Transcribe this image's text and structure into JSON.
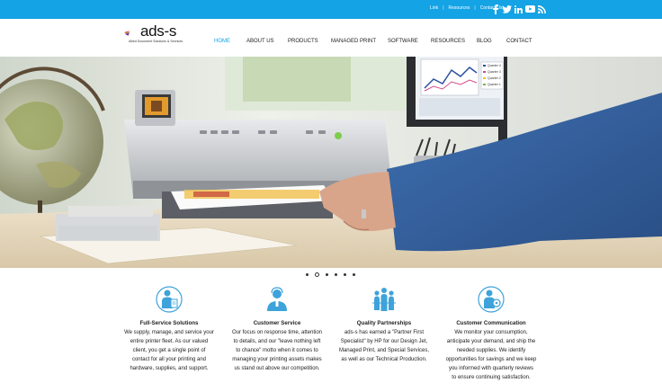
{
  "topbar": {
    "links": [
      "Link",
      "Resources",
      "Contact Us"
    ],
    "social_icons": [
      "facebook-icon",
      "twitter-icon",
      "linkedin-icon",
      "youtube-icon",
      "rss-icon"
    ]
  },
  "brand": {
    "name": "ads-s",
    "tagline": "Allied Document Solutions & Services"
  },
  "nav": {
    "items": [
      {
        "label": "HOME",
        "active": true
      },
      {
        "label": "ABOUT US",
        "active": false
      },
      {
        "label": "PRODUCTS",
        "active": false
      },
      {
        "label": "MANAGED PRINT",
        "active": false
      },
      {
        "label": "SOFTWARE",
        "active": false
      },
      {
        "label": "RESOURCES",
        "active": false
      },
      {
        "label": "BLOG",
        "active": false
      },
      {
        "label": "CONTACT",
        "active": false
      }
    ]
  },
  "hero": {
    "slide_count": 6,
    "active_slide": 2
  },
  "colors": {
    "accent": "#14a3e4",
    "icon_blue": "#3ea3da",
    "text": "#222222"
  },
  "features": [
    {
      "icon": "person-document-icon",
      "title": "Full-Service Solutions",
      "lines": [
        "We supply, manage, and service your",
        "entire printer fleet. As our valued",
        "client, you get a single point of",
        "contact for all your printing and",
        "hardware, supplies, and support."
      ]
    },
    {
      "icon": "support-person-icon",
      "title": "Customer Service",
      "lines": [
        "Our focus on response time, attention",
        "to details, and our \"leave nothing left",
        "to chance\" motto when it comes to",
        "managing your printing assets makes",
        "us stand out above our competition."
      ]
    },
    {
      "icon": "group-partnership-icon",
      "title": "Quality Partnerships",
      "lines": [
        "ads-s has earned a \"Partner First",
        "Specialist\" by HP for our Design Jet,",
        "Managed Print, and Special Services,",
        "as well as our Technical Production."
      ]
    },
    {
      "icon": "person-gear-icon",
      "title": "Customer Communication",
      "lines": [
        "We monitor your consumption,",
        "anticipate your demand, and ship the",
        "needed supplies. We identify",
        "opportunities for savings and we keep",
        "you informed with quarterly reviews",
        "to ensure continuing satisfaction."
      ]
    }
  ],
  "monitor_chart_legend": [
    "Quarter 4",
    "Quarter 3",
    "Quarter 2",
    "Quarter 1"
  ]
}
